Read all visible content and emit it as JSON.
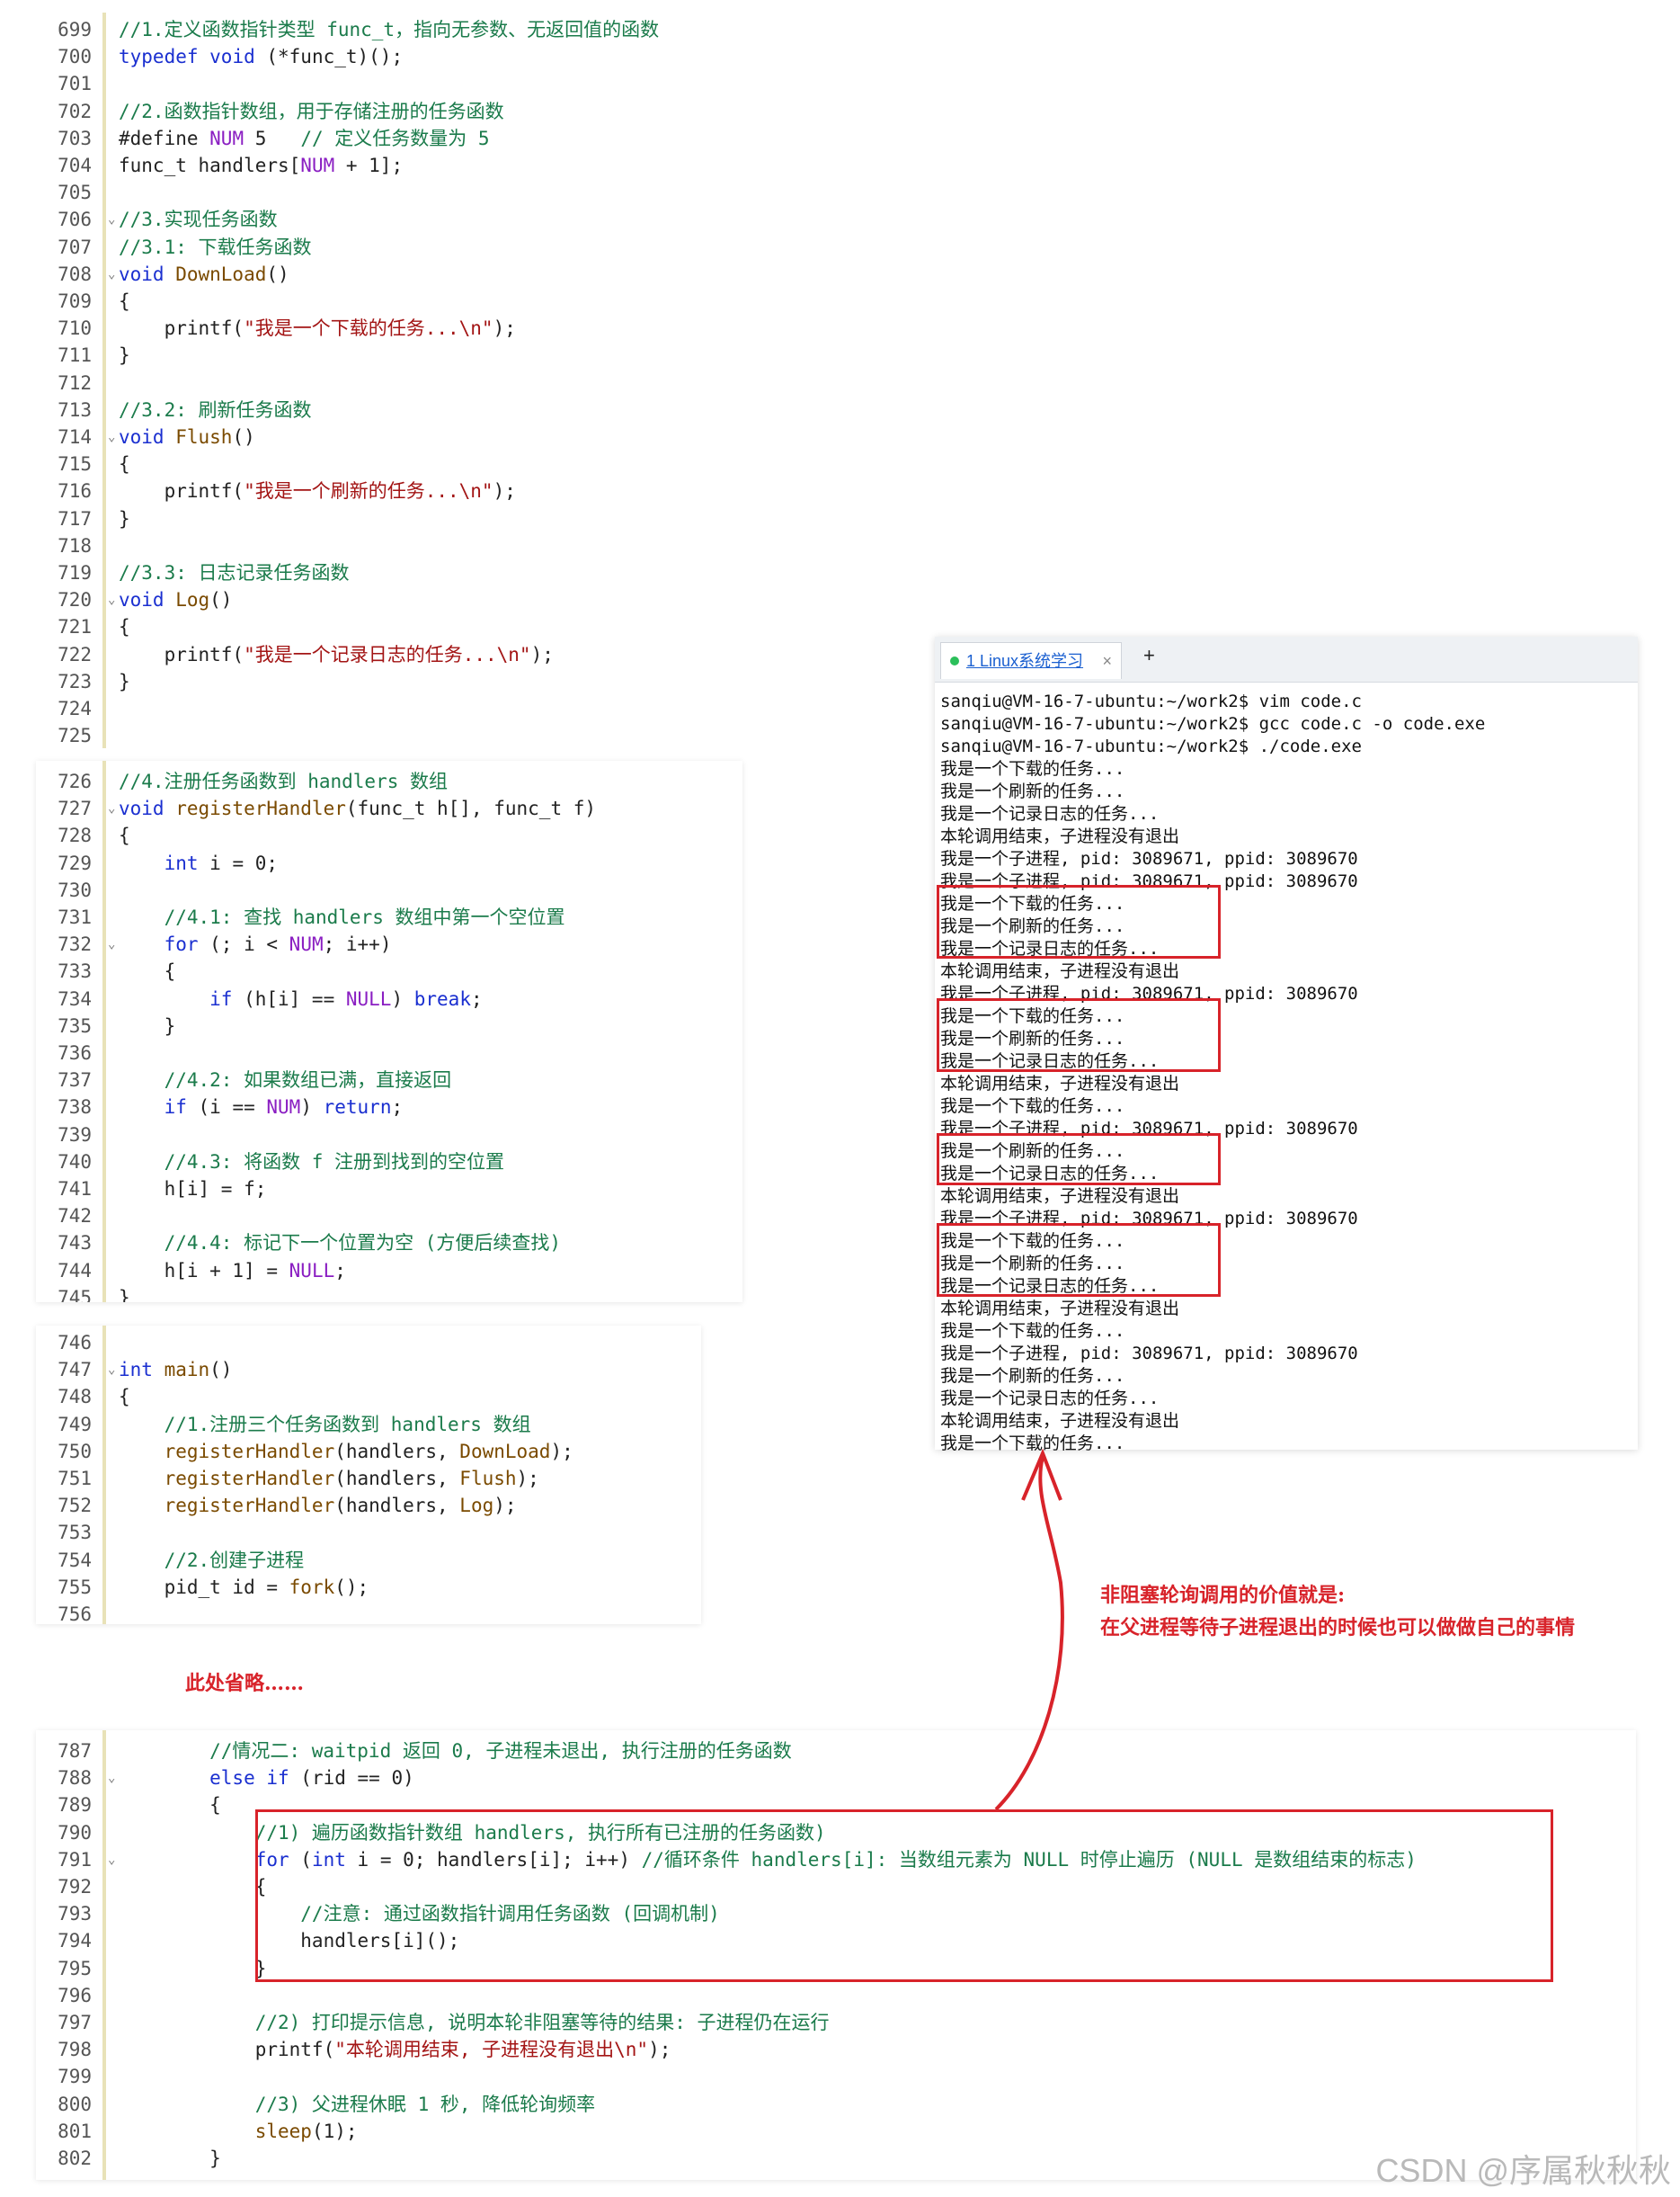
{
  "panel1": {
    "lines": [
      {
        "n": "699",
        "parts": [
          [
            "c",
            "//1.定义函数指针类型 func_t，指向无参数、无返回值的函数"
          ]
        ]
      },
      {
        "n": "700",
        "parts": [
          [
            "k",
            "typedef "
          ],
          [
            "k",
            "void "
          ],
          [
            "p",
            "(*func_t)();"
          ]
        ]
      },
      {
        "n": "701",
        "parts": []
      },
      {
        "n": "702",
        "parts": [
          [
            "c",
            "//2.函数指针数组，用于存储注册的任务函数"
          ]
        ]
      },
      {
        "n": "703",
        "parts": [
          [
            "p",
            "#define "
          ],
          [
            "n",
            "NUM"
          ],
          [
            "p",
            " 5   "
          ],
          [
            "c",
            "// 定义任务数量为 5"
          ]
        ]
      },
      {
        "n": "704",
        "parts": [
          [
            "p",
            "func_t handlers["
          ],
          [
            "n",
            "NUM"
          ],
          [
            "p",
            " + 1];"
          ]
        ]
      },
      {
        "n": "705",
        "parts": []
      },
      {
        "n": "706",
        "fold": true,
        "parts": [
          [
            "c",
            "//3.实现任务函数"
          ]
        ]
      },
      {
        "n": "707",
        "parts": [
          [
            "c",
            "//3.1: 下载任务函数"
          ]
        ]
      },
      {
        "n": "708",
        "fold": true,
        "parts": [
          [
            "k",
            "void "
          ],
          [
            "f",
            "DownLoad"
          ],
          [
            "p",
            "()"
          ]
        ]
      },
      {
        "n": "709",
        "parts": [
          [
            "p",
            "{"
          ]
        ]
      },
      {
        "n": "710",
        "parts": [
          [
            "p",
            "    printf("
          ],
          [
            "s",
            "\"我是一个下载的任务...\\n\""
          ],
          [
            "p",
            ");"
          ]
        ]
      },
      {
        "n": "711",
        "parts": [
          [
            "p",
            "}"
          ]
        ]
      },
      {
        "n": "712",
        "parts": []
      },
      {
        "n": "713",
        "parts": [
          [
            "c",
            "//3.2: 刷新任务函数"
          ]
        ]
      },
      {
        "n": "714",
        "fold": true,
        "parts": [
          [
            "k",
            "void "
          ],
          [
            "f",
            "Flush"
          ],
          [
            "p",
            "()"
          ]
        ]
      },
      {
        "n": "715",
        "parts": [
          [
            "p",
            "{"
          ]
        ]
      },
      {
        "n": "716",
        "parts": [
          [
            "p",
            "    printf("
          ],
          [
            "s",
            "\"我是一个刷新的任务...\\n\""
          ],
          [
            "p",
            ");"
          ]
        ]
      },
      {
        "n": "717",
        "parts": [
          [
            "p",
            "}"
          ]
        ]
      },
      {
        "n": "718",
        "parts": []
      },
      {
        "n": "719",
        "parts": [
          [
            "c",
            "//3.3: 日志记录任务函数"
          ]
        ]
      },
      {
        "n": "720",
        "fold": true,
        "parts": [
          [
            "k",
            "void "
          ],
          [
            "f",
            "Log"
          ],
          [
            "p",
            "()"
          ]
        ]
      },
      {
        "n": "721",
        "parts": [
          [
            "p",
            "{"
          ]
        ]
      },
      {
        "n": "722",
        "parts": [
          [
            "p",
            "    printf("
          ],
          [
            "s",
            "\"我是一个记录日志的任务...\\n\""
          ],
          [
            "p",
            ");"
          ]
        ]
      },
      {
        "n": "723",
        "parts": [
          [
            "p",
            "}"
          ]
        ]
      },
      {
        "n": "724",
        "parts": []
      },
      {
        "n": "725",
        "parts": []
      }
    ]
  },
  "panel2": {
    "lines": [
      {
        "n": "726",
        "parts": [
          [
            "c",
            "//4.注册任务函数到 handlers 数组"
          ]
        ]
      },
      {
        "n": "727",
        "fold": true,
        "parts": [
          [
            "k",
            "void "
          ],
          [
            "f",
            "registerHandler"
          ],
          [
            "p",
            "(func_t h[], func_t f)"
          ]
        ]
      },
      {
        "n": "728",
        "parts": [
          [
            "p",
            "{"
          ]
        ]
      },
      {
        "n": "729",
        "parts": [
          [
            "k",
            "    int "
          ],
          [
            "p",
            "i = 0;"
          ]
        ]
      },
      {
        "n": "730",
        "parts": []
      },
      {
        "n": "731",
        "parts": [
          [
            "c",
            "    //4.1: 查找 handlers 数组中第一个空位置"
          ]
        ]
      },
      {
        "n": "732",
        "fold": true,
        "parts": [
          [
            "k",
            "    for "
          ],
          [
            "p",
            "(; i < "
          ],
          [
            "n",
            "NUM"
          ],
          [
            "p",
            "; i++)"
          ]
        ]
      },
      {
        "n": "733",
        "parts": [
          [
            "p",
            "    {"
          ]
        ]
      },
      {
        "n": "734",
        "parts": [
          [
            "k",
            "        if "
          ],
          [
            "p",
            "(h[i] == "
          ],
          [
            "n",
            "NULL"
          ],
          [
            "p",
            ") "
          ],
          [
            "k",
            "break"
          ],
          [
            "p",
            ";"
          ]
        ]
      },
      {
        "n": "735",
        "parts": [
          [
            "p",
            "    }"
          ]
        ]
      },
      {
        "n": "736",
        "parts": []
      },
      {
        "n": "737",
        "parts": [
          [
            "c",
            "    //4.2: 如果数组已满，直接返回"
          ]
        ]
      },
      {
        "n": "738",
        "parts": [
          [
            "k",
            "    if "
          ],
          [
            "p",
            "(i == "
          ],
          [
            "n",
            "NUM"
          ],
          [
            "p",
            ") "
          ],
          [
            "k",
            "return"
          ],
          [
            "p",
            ";"
          ]
        ]
      },
      {
        "n": "739",
        "parts": []
      },
      {
        "n": "740",
        "parts": [
          [
            "c",
            "    //4.3: 将函数 f 注册到找到的空位置"
          ]
        ]
      },
      {
        "n": "741",
        "parts": [
          [
            "p",
            "    h[i] = f;"
          ]
        ]
      },
      {
        "n": "742",
        "parts": []
      },
      {
        "n": "743",
        "parts": [
          [
            "c",
            "    //4.4: 标记下一个位置为空 (方便后续查找)"
          ]
        ]
      },
      {
        "n": "744",
        "parts": [
          [
            "p",
            "    h[i + 1] = "
          ],
          [
            "n",
            "NULL"
          ],
          [
            "p",
            ";"
          ]
        ]
      },
      {
        "n": "745",
        "parts": [
          [
            "p",
            "}"
          ]
        ]
      }
    ]
  },
  "panel3": {
    "lines": [
      {
        "n": "746",
        "parts": []
      },
      {
        "n": "747",
        "fold": true,
        "parts": [
          [
            "k",
            "int "
          ],
          [
            "f",
            "main"
          ],
          [
            "p",
            "()"
          ]
        ]
      },
      {
        "n": "748",
        "parts": [
          [
            "p",
            "{"
          ]
        ]
      },
      {
        "n": "749",
        "parts": [
          [
            "c",
            "    //1.注册三个任务函数到 handlers 数组"
          ]
        ]
      },
      {
        "n": "750",
        "parts": [
          [
            "f",
            "    registerHandler"
          ],
          [
            "p",
            "(handlers, "
          ],
          [
            "f",
            "DownLoad"
          ],
          [
            "p",
            ");"
          ]
        ]
      },
      {
        "n": "751",
        "parts": [
          [
            "f",
            "    registerHandler"
          ],
          [
            "p",
            "(handlers, "
          ],
          [
            "f",
            "Flush"
          ],
          [
            "p",
            ");"
          ]
        ]
      },
      {
        "n": "752",
        "parts": [
          [
            "f",
            "    registerHandler"
          ],
          [
            "p",
            "(handlers, "
          ],
          [
            "f",
            "Log"
          ],
          [
            "p",
            ");"
          ]
        ]
      },
      {
        "n": "753",
        "parts": []
      },
      {
        "n": "754",
        "parts": [
          [
            "c",
            "    //2.创建子进程"
          ]
        ]
      },
      {
        "n": "755",
        "parts": [
          [
            "p",
            "    pid_t id = "
          ],
          [
            "f",
            "fork"
          ],
          [
            "p",
            "();"
          ]
        ]
      },
      {
        "n": "756",
        "parts": []
      }
    ]
  },
  "panel4": {
    "lines": [
      {
        "n": "787",
        "parts": [
          [
            "c",
            "        //情况二: waitpid 返回 0, 子进程未退出, 执行注册的任务函数"
          ]
        ]
      },
      {
        "n": "788",
        "fold": true,
        "parts": [
          [
            "k",
            "        else if "
          ],
          [
            "p",
            "(rid == 0)"
          ]
        ]
      },
      {
        "n": "789",
        "parts": [
          [
            "p",
            "        {"
          ]
        ]
      },
      {
        "n": "790",
        "parts": [
          [
            "c",
            "            //1) 遍历函数指针数组 handlers, 执行所有已注册的任务函数)"
          ]
        ]
      },
      {
        "n": "791",
        "fold": true,
        "parts": [
          [
            "k",
            "            for "
          ],
          [
            "p",
            "("
          ],
          [
            "k",
            "int "
          ],
          [
            "p",
            "i = 0; handlers[i]; i++) "
          ],
          [
            "c",
            "//循环条件 handlers[i]: 当数组元素为 NULL 时停止遍历 (NULL 是数组结束的标志)"
          ]
        ]
      },
      {
        "n": "792",
        "parts": [
          [
            "p",
            "            {"
          ]
        ]
      },
      {
        "n": "793",
        "parts": [
          [
            "c",
            "                //注意: 通过函数指针调用任务函数 (回调机制)"
          ]
        ]
      },
      {
        "n": "794",
        "parts": [
          [
            "p",
            "                handlers[i]();"
          ]
        ]
      },
      {
        "n": "795",
        "parts": [
          [
            "p",
            "            }"
          ]
        ]
      },
      {
        "n": "796",
        "parts": []
      },
      {
        "n": "797",
        "parts": [
          [
            "c",
            "            //2) 打印提示信息, 说明本轮非阻塞等待的结果: 子进程仍在运行"
          ]
        ]
      },
      {
        "n": "798",
        "parts": [
          [
            "p",
            "            printf("
          ],
          [
            "s",
            "\"本轮调用结束, 子进程没有退出\\n\""
          ],
          [
            "p",
            ");"
          ]
        ]
      },
      {
        "n": "799",
        "parts": []
      },
      {
        "n": "800",
        "parts": [
          [
            "c",
            "            //3) 父进程休眠 1 秒, 降低轮询频率"
          ]
        ]
      },
      {
        "n": "801",
        "parts": [
          [
            "f",
            "            sleep"
          ],
          [
            "p",
            "(1);"
          ]
        ]
      },
      {
        "n": "802",
        "parts": [
          [
            "p",
            "        }"
          ]
        ]
      }
    ]
  },
  "omitted_label": "此处省略……",
  "terminal": {
    "tab_label": "1 Linux系统学习",
    "tab_close": "×",
    "tab_add": "+",
    "lines": [
      "sanqiu@VM-16-7-ubuntu:~/work2$ vim code.c",
      "sanqiu@VM-16-7-ubuntu:~/work2$ gcc code.c -o code.exe",
      "sanqiu@VM-16-7-ubuntu:~/work2$ ./code.exe",
      "我是一个下载的任务...",
      "我是一个刷新的任务...",
      "我是一个记录日志的任务...",
      "本轮调用结束，子进程没有退出",
      "我是一个子进程, pid: 3089671, ppid: 3089670",
      "我是一个子进程, pid: 3089671, ppid: 3089670",
      "我是一个下载的任务...",
      "我是一个刷新的任务...",
      "我是一个记录日志的任务...",
      "本轮调用结束，子进程没有退出",
      "我是一个子进程, pid: 3089671, ppid: 3089670",
      "我是一个下载的任务...",
      "我是一个刷新的任务...",
      "我是一个记录日志的任务...",
      "本轮调用结束，子进程没有退出",
      "我是一个下载的任务...",
      "我是一个子进程, pid: 3089671, ppid: 3089670",
      "我是一个刷新的任务...",
      "我是一个记录日志的任务...",
      "本轮调用结束，子进程没有退出",
      "我是一个子进程, pid: 3089671, ppid: 3089670",
      "我是一个下载的任务...",
      "我是一个刷新的任务...",
      "我是一个记录日志的任务...",
      "本轮调用结束，子进程没有退出",
      "我是一个下载的任务...",
      "我是一个子进程, pid: 3089671, ppid: 3089670",
      "我是一个刷新的任务...",
      "我是一个记录日志的任务...",
      "本轮调用结束，子进程没有退出",
      "我是一个下载的任务..."
    ]
  },
  "annotation": {
    "line1": "非阻塞轮询调用的价值就是:",
    "line2": "在父进程等待子进程退出的时候也可以做做自己的事情"
  },
  "watermark": "CSDN @序属秋秋秋",
  "colors": {
    "highlight_red": "#d8232a",
    "comment": "#1b7b4b",
    "keyword": "#1a2fd0",
    "string": "#a31515"
  }
}
